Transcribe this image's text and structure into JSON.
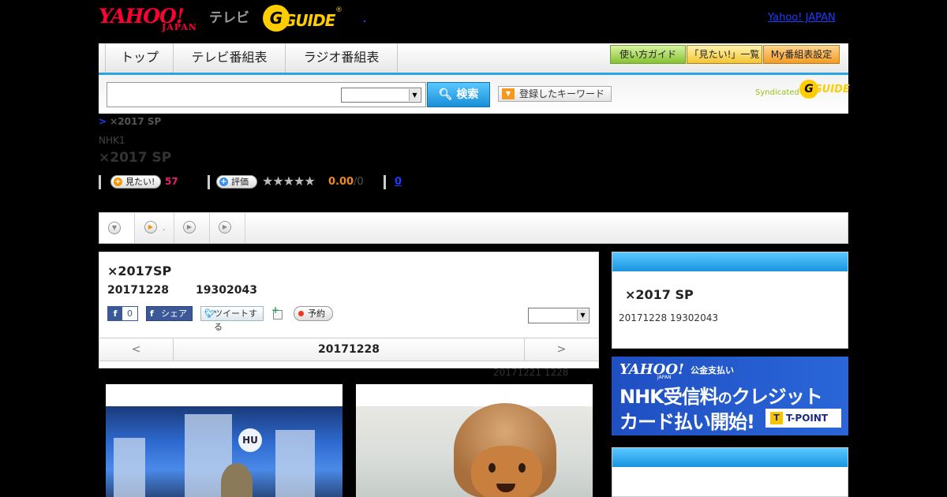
{
  "header": {
    "yahoo_logo": "YAHOO!",
    "yahoo_sub": "JAPAN",
    "tv_label": "テレビ",
    "gguide_g": "G",
    "gguide_text": "GUIDE",
    "gguide_reg": "®",
    "yahoo_japan_link": "Yahoo! JAPAN"
  },
  "nav": {
    "tabs": [
      {
        "label": "トップ"
      },
      {
        "label": "テレビ番組表"
      },
      {
        "label": "ラジオ番組表"
      }
    ],
    "buttons": [
      {
        "label": "使い方ガイド"
      },
      {
        "label": "「見たい!」一覧"
      },
      {
        "label": "My番組表設定"
      }
    ]
  },
  "search": {
    "input_value": "",
    "search_button": "検索",
    "keyword_button": "登録したキーワード",
    "syndicated": "Syndicated",
    "syndicated_g": "G",
    "syndicated_guide": "GUIDE"
  },
  "program": {
    "breadcrumb_sep": ">",
    "breadcrumb": "×2017 SP",
    "channel": "NHK1",
    "title": "×2017 SP",
    "mitai_label": "見たい!",
    "mitai_count": "57",
    "rate_label": "評価",
    "stars": "★★★★★",
    "score": "0.00",
    "score_total": "/0",
    "comments": "0"
  },
  "strip": {
    "tab2_suffix": "."
  },
  "detail": {
    "title": "×2017SP",
    "date": "20171228",
    "time": "19302043",
    "fb_count": "0",
    "fb_share": "シェア",
    "tweet": "ツイートする",
    "reserve": "予約",
    "nav_prev": "<",
    "nav_date": "20171228",
    "nav_next": ">",
    "period": "20171221  1228"
  },
  "images": {
    "img1_sign": "HU"
  },
  "side": {
    "title": "×2017 SP",
    "datetime": "20171228  19302043"
  },
  "ad": {
    "yahoo": "YAHOO!",
    "japan": "JAPAN",
    "kokin": "公金支払い",
    "line1_a": "NHK受信料",
    "line1_b": "の",
    "line1_c": "クレジット",
    "line2": "カード払い開始!",
    "tpoint": "T-POINT",
    "tpoint_t": "T"
  }
}
